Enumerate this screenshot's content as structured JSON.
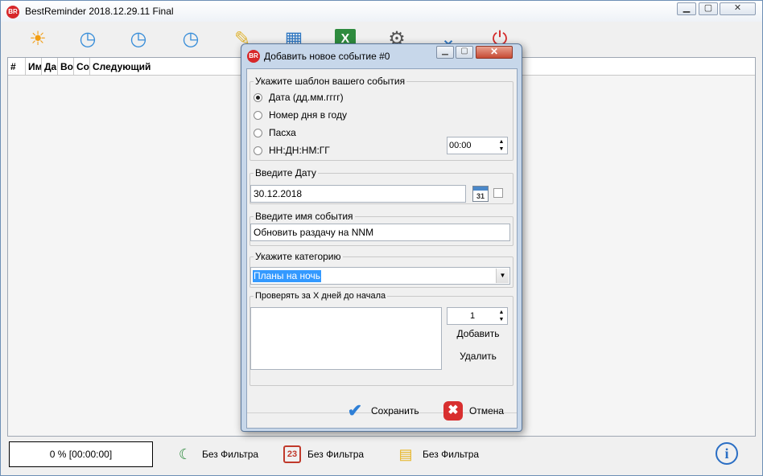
{
  "app": {
    "title": "BestReminder 2018.12.29.11 Final",
    "icon_text": "BR",
    "window_controls": {
      "minimize": "▁",
      "maximize": "▢",
      "close": "✕"
    }
  },
  "toolbar": {
    "buttons": [
      {
        "icon": "sun-icon",
        "glyph": "☀",
        "color": "#f29d12"
      },
      {
        "icon": "clock-icon",
        "glyph": "◷",
        "color": "#3b8fd9"
      },
      {
        "icon": "clock-edit-icon",
        "glyph": "◷",
        "color": "#3b8fd9"
      },
      {
        "icon": "clock-delete-icon",
        "glyph": "◷",
        "color": "#3b8fd9"
      },
      {
        "icon": "palette-icon",
        "glyph": "✎",
        "color": "#e0b63a"
      },
      {
        "icon": "blocks-icon",
        "glyph": "▦",
        "color": "#2f77c2"
      },
      {
        "icon": "excel-icon",
        "glyph": "X",
        "color": "#2e8b3e"
      },
      {
        "icon": "gear-icon",
        "glyph": "⚙",
        "color": "#555555"
      },
      {
        "icon": "chevrons-down-icon",
        "glyph": "⌄",
        "color": "#2f77c2"
      },
      {
        "icon": "power-icon",
        "glyph": "⏻",
        "color": "#d42a2a"
      }
    ]
  },
  "grid": {
    "columns": [
      "#",
      "Им",
      "Да",
      "Во",
      "Со",
      "Следующий"
    ]
  },
  "status": {
    "progress": "0 % [00:00:00]",
    "filters": [
      {
        "icon": "moon-icon",
        "glyph": "☾",
        "color": "#2e8b3e",
        "label": "Без Фильтра"
      },
      {
        "icon": "calendar-icon",
        "glyph": "23",
        "color": "#c0392b",
        "label": "Без Фильтра"
      },
      {
        "icon": "folders-icon",
        "glyph": "▤",
        "color": "#e6b422",
        "label": "Без Фильтра"
      }
    ],
    "info_icon": "i"
  },
  "dialog": {
    "title": "Добавить новое событие #0",
    "icon_text": "BR",
    "controls": {
      "minimize": "▁",
      "maximize": "▢",
      "close": "✕"
    },
    "template_group": {
      "legend": "Укажите шаблон вашего события",
      "options": [
        {
          "label": "Дата (дд.мм.гггг)",
          "selected": true
        },
        {
          "label": "Номер дня в году",
          "selected": false
        },
        {
          "label": "Пасха",
          "selected": false
        },
        {
          "label": "НН:ДН:НМ:ГГ",
          "selected": false
        }
      ],
      "time_value": "00:00"
    },
    "date_group": {
      "legend": "Введите Дату",
      "value": "30.12.2018",
      "calendar_icon_text": "31"
    },
    "name_group": {
      "legend": "Введите  имя события",
      "value": "Обновить раздачу на NNM"
    },
    "category_group": {
      "legend": "Укажите категорию",
      "value": "Планы на ночь",
      "dropdown_arrow": "▼"
    },
    "days_group": {
      "legend": "Проверять за X дней до начала",
      "spin_value": "1",
      "add_label": "Добавить",
      "delete_label": "Удалить"
    },
    "footer": {
      "save_label": "Сохранить",
      "cancel_label": "Отмена"
    }
  }
}
